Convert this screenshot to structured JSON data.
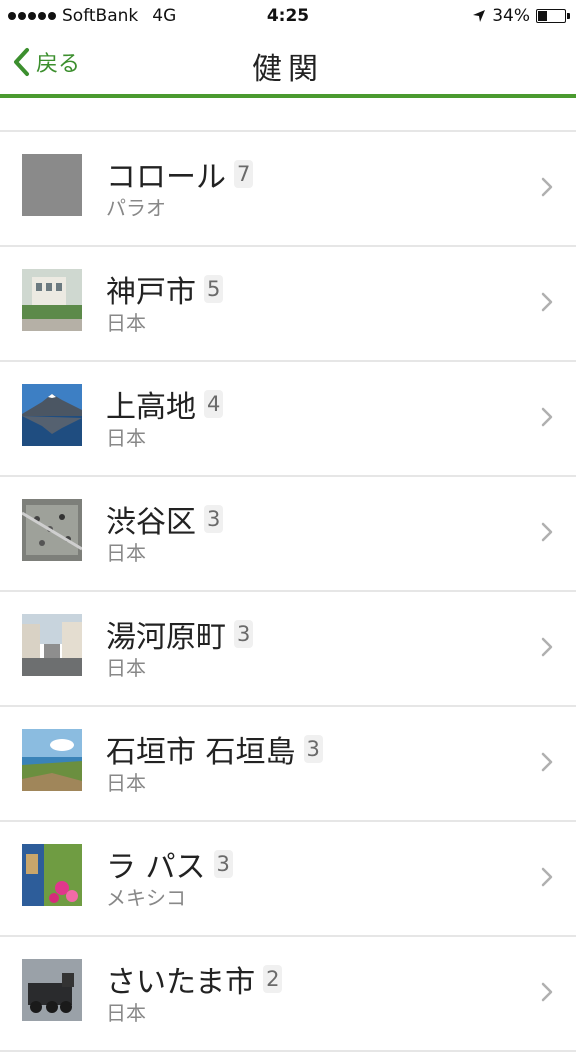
{
  "status": {
    "carrier": "SoftBank",
    "network": "4G",
    "time": "4:25",
    "battery": "34%",
    "battery_level": 0.34
  },
  "nav": {
    "back_label": "戻る",
    "title": "健関"
  },
  "accent_color": "#3c8f2e",
  "items": [
    {
      "name": "コロール",
      "count": "7",
      "country": "パラオ",
      "thumb": "gray-placeholder"
    },
    {
      "name": "神戸市",
      "count": "5",
      "country": "日本",
      "thumb": "building"
    },
    {
      "name": "上高地",
      "count": "4",
      "country": "日本",
      "thumb": "mountain-lake"
    },
    {
      "name": "渋谷区",
      "count": "3",
      "country": "日本",
      "thumb": "crowd"
    },
    {
      "name": "湯河原町",
      "count": "3",
      "country": "日本",
      "thumb": "street"
    },
    {
      "name": "石垣市 石垣島",
      "count": "3",
      "country": "日本",
      "thumb": "coast"
    },
    {
      "name": "ラ パス",
      "count": "3",
      "country": "メキシコ",
      "thumb": "flowers"
    },
    {
      "name": "さいたま市",
      "count": "2",
      "country": "日本",
      "thumb": "locomotive"
    }
  ]
}
